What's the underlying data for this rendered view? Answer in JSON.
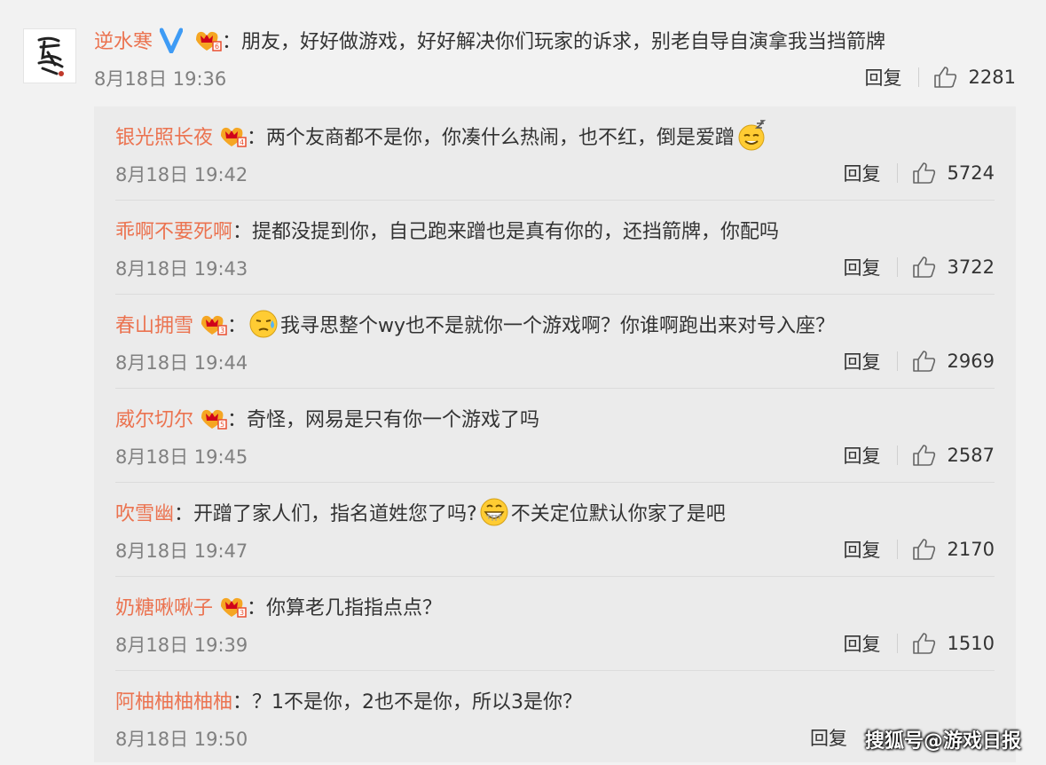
{
  "main_comment": {
    "username": "逆水寒",
    "text": "：朋友，好好做游戏，好好解决你们玩家的诉求，别老自导自演拿我当挡箭牌",
    "time": "8月18日 19:36",
    "reply_label": "回复",
    "likes": "2281"
  },
  "replies": [
    {
      "username": "银光照长夜",
      "text": "：两个友商都不是你，你凑什么热闹，也不红，倒是爱蹭",
      "emoji_after": "smug-face",
      "time": "8月18日 19:42",
      "reply_label": "回复",
      "likes": "5724"
    },
    {
      "username": "乖啊不要死啊",
      "text": "：提都没提到你，自己跑来蹭也是真有你的，还挡箭牌，你配吗",
      "time": "8月18日 19:43",
      "reply_label": "回复",
      "likes": "3722"
    },
    {
      "username": "春山拥雪",
      "text_before": "：",
      "text": "我寻思整个wy也不是就你一个游戏啊？你谁啊跑出来对号入座？",
      "emoji_before": "sweat-face",
      "time": "8月18日 19:44",
      "reply_label": "回复",
      "likes": "2969"
    },
    {
      "username": "威尔切尔",
      "text": "：奇怪，网易是只有你一个游戏了吗",
      "time": "8月18日 19:45",
      "reply_label": "回复",
      "likes": "2587"
    },
    {
      "username": "吹雪幽",
      "text": "：开蹭了家人们，指名道姓您了吗?",
      "emoji_mid": "grin-face",
      "text_after": "不关定位默认你家了是吧",
      "time": "8月18日 19:47",
      "reply_label": "回复",
      "likes": "2170"
    },
    {
      "username": "奶糖啾啾子",
      "text": "：你算老几指指点点？",
      "time": "8月18日 19:39",
      "reply_label": "回复",
      "likes": "1510"
    },
    {
      "username": "阿柚柚柚柚柚",
      "text": "：？1不是你，2也不是你，所以3是你？",
      "time": "8月18日 19:50",
      "reply_label": "回复",
      "likes": ""
    }
  ],
  "watermark": "搜狐号@游戏日报",
  "colors": {
    "username": "#eb7350",
    "text": "#333333",
    "meta": "#808080",
    "vip_badge": "#f5a623",
    "verified_v": "#3e9bf5"
  }
}
